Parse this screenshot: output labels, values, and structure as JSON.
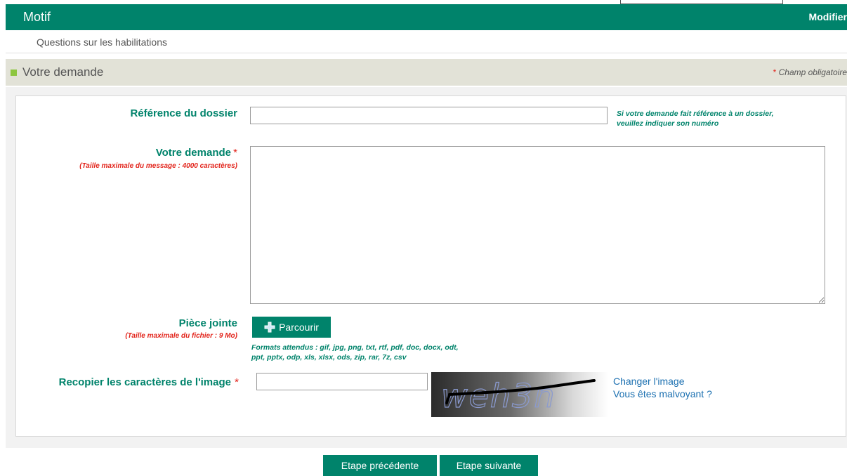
{
  "header": {
    "title": "Motif",
    "modify_label": "Modifier"
  },
  "motif": {
    "value": "Questions sur les habilitations"
  },
  "section": {
    "title": "Votre demande",
    "required_star": "*",
    "required_note": "Champ obligatoire"
  },
  "form": {
    "reference": {
      "label": "Référence du dossier",
      "value": "",
      "hint_line1": "Si votre demande fait référence à un dossier,",
      "hint_line2": "veuillez indiquer son numéro"
    },
    "request": {
      "label": "Votre demande",
      "required_star": "*",
      "sublabel": "(Taille maximale du message : 4000 caractères)",
      "value": ""
    },
    "attachment": {
      "label": "Pièce jointe",
      "sublabel": "(Taille maximale du fichier : 9 Mo)",
      "browse_label": "Parcourir",
      "formats_line1": "Formats attendus : gif, jpg, png, txt, rtf, pdf, doc, docx, odt,",
      "formats_line2": "ppt, pptx, odp, xls, xlsx, ods, zip, rar, 7z, csv"
    },
    "captcha": {
      "label": "Recopier les caractères de l'image",
      "required_star": "*",
      "value": "",
      "image_text": "weh3n",
      "change_image_label": "Changer l'image",
      "visually_impaired_label": "Vous êtes malvoyant ?"
    }
  },
  "navigation": {
    "previous_label": "Etape précédente",
    "next_label": "Etape suivante"
  },
  "colors": {
    "brand_green": "#00836b",
    "accent_light_green": "#8dc63f",
    "required_red": "#e2231a",
    "link_blue": "#1a6fb0",
    "section_bg": "#e2e2d7"
  }
}
